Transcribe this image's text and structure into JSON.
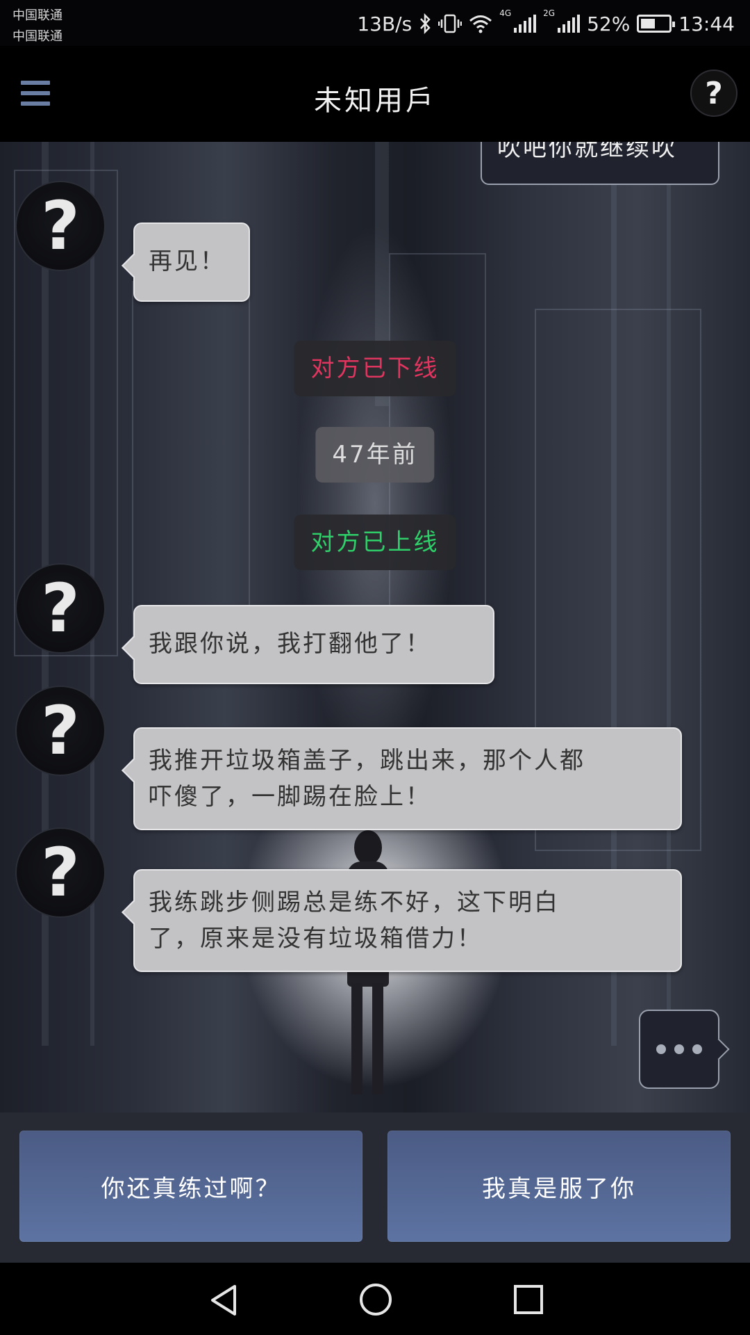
{
  "status_bar": {
    "carrier_1": "中国联通",
    "carrier_2": "中国联通",
    "speed": "13B/s",
    "net1": "4G",
    "net2": "2G",
    "battery": "52%",
    "battery_level": 0.52,
    "time": "13:44"
  },
  "header": {
    "title": "未知用戶",
    "help_label": "?"
  },
  "messages": {
    "partial_right": "吹吧你就继续吹",
    "avatar_glyph": "?",
    "m1": "再见！",
    "sys_offline": "对方已下线",
    "sys_offline_color": "#e0355f",
    "sys_time": "47年前",
    "sys_online": "对方已上线",
    "sys_online_color": "#2fd06a",
    "m2": "我跟你说，我打翻他了！",
    "m3_line1": "我推开垃圾箱盖子，跳出来，那个人都",
    "m3_line2": "吓傻了，一脚踢在脸上！",
    "m4_line1": "我练跳步侧踢总是练不好，这下明白",
    "m4_line2": "了，原来是没有垃圾箱借力！"
  },
  "replies": {
    "option_1": "你还真练过啊？",
    "option_2": "我真是服了你"
  },
  "icons": {
    "menu": "menu-icon",
    "help": "help-icon",
    "back": "back-icon",
    "home": "home-icon",
    "recent": "recent-apps-icon",
    "bluetooth": "bluetooth-icon",
    "vibrate": "vibrate-icon",
    "wifi": "wifi-icon",
    "battery": "battery-icon",
    "typing": "typing-indicator-icon"
  },
  "colors": {
    "accent": "#5d73a2",
    "bubble": "#c3c3c5"
  }
}
